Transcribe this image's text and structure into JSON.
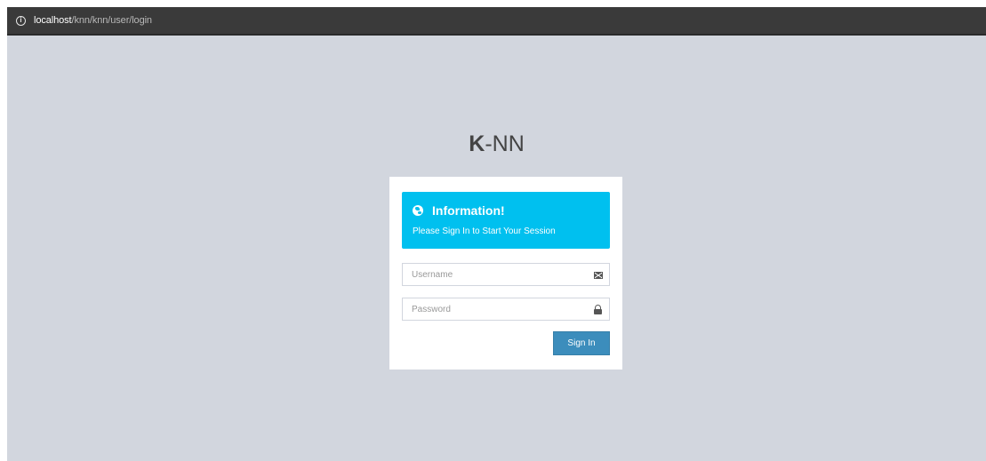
{
  "browser": {
    "url_host": "localhost",
    "url_path": "/knn/knn/user/login"
  },
  "logo": {
    "bold": "K",
    "rest": "-NN"
  },
  "callout": {
    "title": "Information!",
    "message": "Please Sign In to Start Your Session",
    "color": "#00c0ef"
  },
  "form": {
    "username_placeholder": "Username",
    "username_value": "",
    "password_placeholder": "Password",
    "password_value": "",
    "username_icon": "envelope-icon",
    "password_icon": "lock-icon",
    "submit_label": "Sign In",
    "submit_color": "#3c8dbc"
  },
  "colors": {
    "page_background": "#d2d6de",
    "browser_bar": "#3a3a3a"
  }
}
